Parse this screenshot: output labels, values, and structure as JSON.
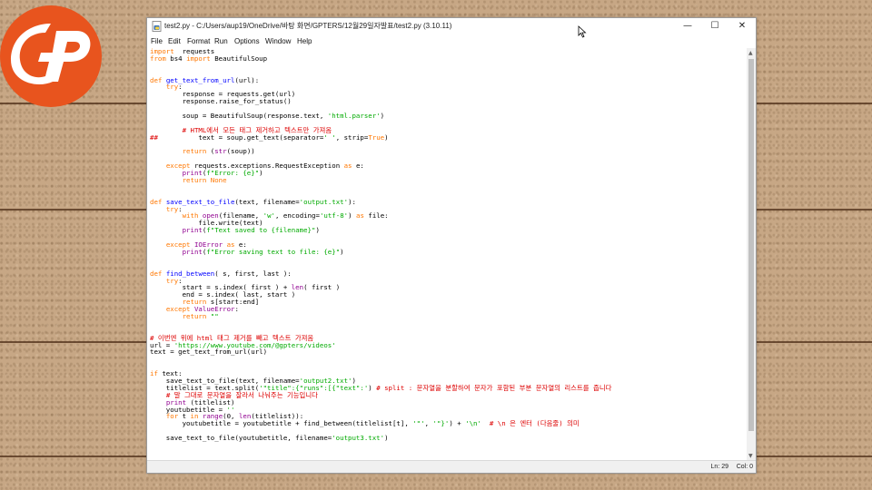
{
  "window": {
    "title": "test2.py - C:/Users/aup19/OneDrive/바탕 화면/GPTERS/12월29일자발표/test2.py (3.10.11)",
    "controls": {
      "minimize": "—",
      "maximize": "☐",
      "close": "✕"
    }
  },
  "menu": [
    "File",
    "Edit",
    "Format",
    "Run",
    "Options",
    "Window",
    "Help"
  ],
  "code": [
    [
      [
        "kw",
        "import"
      ],
      [
        "",
        "  requests"
      ]
    ],
    [
      [
        "kw",
        "from"
      ],
      [
        "",
        " bs4 "
      ],
      [
        "kw",
        "import"
      ],
      [
        "",
        " BeautifulSoup"
      ]
    ],
    [],
    [],
    [
      [
        "kw",
        "def"
      ],
      [
        "",
        " "
      ],
      [
        "df",
        "get_text_from_url"
      ],
      [
        "",
        "(url):"
      ]
    ],
    [
      [
        "",
        "    "
      ],
      [
        "kw",
        "try"
      ],
      [
        "",
        ":"
      ]
    ],
    [
      [
        "",
        "        response = requests.get(url)"
      ]
    ],
    [
      [
        "",
        "        response.raise_for_status()"
      ]
    ],
    [],
    [
      [
        "",
        "        soup = BeautifulSoup(response.text, "
      ],
      [
        "st",
        "'html.parser'"
      ],
      [
        "",
        ")"
      ]
    ],
    [],
    [
      [
        "",
        "        "
      ],
      [
        "cm",
        "# HTML에서 모든 태그 제거하고 텍스트만 가져옴"
      ]
    ],
    [
      [
        "cm",
        "##"
      ],
      [
        "",
        "          text = soup.get_text(separator="
      ],
      [
        "st",
        "' '"
      ],
      [
        "",
        ", strip="
      ],
      [
        "kw",
        "True"
      ],
      [
        "",
        ")"
      ]
    ],
    [],
    [
      [
        "",
        "        "
      ],
      [
        "kw",
        "return"
      ],
      [
        "",
        " ("
      ],
      [
        "bi",
        "str"
      ],
      [
        "",
        "(soup))"
      ]
    ],
    [],
    [
      [
        "",
        "    "
      ],
      [
        "kw",
        "except"
      ],
      [
        "",
        " requests.exceptions.RequestException "
      ],
      [
        "kw",
        "as"
      ],
      [
        "",
        " e:"
      ]
    ],
    [
      [
        "",
        "        "
      ],
      [
        "bi",
        "print"
      ],
      [
        "",
        "("
      ],
      [
        "st",
        "f\"Error: {e}\""
      ],
      [
        "",
        ")"
      ]
    ],
    [
      [
        "",
        "        "
      ],
      [
        "kw",
        "return"
      ],
      [
        "",
        " "
      ],
      [
        "kw",
        "None"
      ]
    ],
    [],
    [],
    [
      [
        "kw",
        "def"
      ],
      [
        "",
        " "
      ],
      [
        "df",
        "save_text_to_file"
      ],
      [
        "",
        "(text, filename="
      ],
      [
        "st",
        "'output.txt'"
      ],
      [
        "",
        "):"
      ]
    ],
    [
      [
        "",
        "    "
      ],
      [
        "kw",
        "try"
      ],
      [
        "",
        ":"
      ]
    ],
    [
      [
        "",
        "        "
      ],
      [
        "kw",
        "with"
      ],
      [
        "",
        " "
      ],
      [
        "bi",
        "open"
      ],
      [
        "",
        "(filename, "
      ],
      [
        "st",
        "'w'"
      ],
      [
        "",
        ", encoding="
      ],
      [
        "st",
        "'utf-8'"
      ],
      [
        "",
        ") "
      ],
      [
        "kw",
        "as"
      ],
      [
        "",
        " file:"
      ]
    ],
    [
      [
        "",
        "            file.write(text)"
      ]
    ],
    [
      [
        "",
        "        "
      ],
      [
        "bi",
        "print"
      ],
      [
        "",
        "("
      ],
      [
        "st",
        "f\"Text saved to {filename}\""
      ],
      [
        "",
        ")"
      ]
    ],
    [],
    [
      [
        "",
        "    "
      ],
      [
        "kw",
        "except"
      ],
      [
        "",
        " "
      ],
      [
        "bi",
        "IOError"
      ],
      [
        "",
        " "
      ],
      [
        "kw",
        "as"
      ],
      [
        "",
        " e:"
      ]
    ],
    [
      [
        "",
        "        "
      ],
      [
        "bi",
        "print"
      ],
      [
        "",
        "("
      ],
      [
        "st",
        "f\"Error saving text to file: {e}\""
      ],
      [
        "",
        ")"
      ]
    ],
    [],
    [],
    [
      [
        "kw",
        "def"
      ],
      [
        "",
        " "
      ],
      [
        "df",
        "find_between"
      ],
      [
        "",
        "( s, first, last ):"
      ]
    ],
    [
      [
        "",
        "    "
      ],
      [
        "kw",
        "try"
      ],
      [
        "",
        ":"
      ]
    ],
    [
      [
        "",
        "        start = s.index( first ) + "
      ],
      [
        "bi",
        "len"
      ],
      [
        "",
        "( first )"
      ]
    ],
    [
      [
        "",
        "        end = s.index( last, start )"
      ]
    ],
    [
      [
        "",
        "        "
      ],
      [
        "kw",
        "return"
      ],
      [
        "",
        " s[start:end]"
      ]
    ],
    [
      [
        "",
        "    "
      ],
      [
        "kw",
        "except"
      ],
      [
        "",
        " "
      ],
      [
        "bi",
        "ValueError"
      ],
      [
        "",
        ":"
      ]
    ],
    [
      [
        "",
        "        "
      ],
      [
        "kw",
        "return"
      ],
      [
        "",
        " "
      ],
      [
        "st",
        "\"\""
      ]
    ],
    [],
    [],
    [
      [
        "cm",
        "# 이번엔 위에 html 태그 제거를 빼고 텍스트 가져옴"
      ]
    ],
    [
      [
        "",
        "url = "
      ],
      [
        "st",
        "'https://www.youtube.com/@gpters/videos'"
      ]
    ],
    [
      [
        "",
        "text = get_text_from_url(url)"
      ]
    ],
    [],
    [],
    [
      [
        "kw",
        "if"
      ],
      [
        "",
        " text:"
      ]
    ],
    [
      [
        "",
        "    save_text_to_file(text, filename="
      ],
      [
        "st",
        "'output2.txt'"
      ],
      [
        "",
        ")"
      ]
    ],
    [
      [
        "",
        "    titlelist = text.split("
      ],
      [
        "st",
        "'\"title\":{\"runs\":[{\"text\":'"
      ],
      [
        "",
        ") "
      ],
      [
        "cm",
        "# split : 문자열을 분할하여 문자가 포함된 부분 문자열의 리스트를 줍니다"
      ]
    ],
    [
      [
        "",
        "    "
      ],
      [
        "cm",
        "# 말 그대로 문자열을 잘라서 나눠주는 기능입니다"
      ]
    ],
    [
      [
        "",
        "    "
      ],
      [
        "bi",
        "print"
      ],
      [
        "",
        " (titlelist)"
      ]
    ],
    [
      [
        "",
        "    youtubetitle = "
      ],
      [
        "st",
        "''"
      ]
    ],
    [
      [
        "",
        "    "
      ],
      [
        "kw",
        "for"
      ],
      [
        "",
        " t "
      ],
      [
        "kw",
        "in"
      ],
      [
        "",
        " "
      ],
      [
        "bi",
        "range"
      ],
      [
        "",
        "(0, "
      ],
      [
        "bi",
        "len"
      ],
      [
        "",
        "(titlelist)):"
      ]
    ],
    [
      [
        "",
        "        youtubetitle = youtubetitle + find_between(titlelist[t], "
      ],
      [
        "st",
        "'\"'"
      ],
      [
        "",
        ", "
      ],
      [
        "st",
        "'\"}'"
      ],
      [
        "",
        ") + "
      ],
      [
        "st",
        "'\\n'"
      ],
      [
        "",
        "  "
      ],
      [
        "cm",
        "# \\n 은 엔터 (다음줄) 의미"
      ]
    ],
    [],
    [
      [
        "",
        "    save_text_to_file(youtubetitle, filename="
      ],
      [
        "st",
        "'output3.txt'"
      ],
      [
        "",
        ")"
      ]
    ]
  ],
  "status": {
    "line": "Ln: 29",
    "col": "Col: 0"
  },
  "colors": {
    "keyword": "#ff7700",
    "builtin": "#900090",
    "string": "#00aa00",
    "comment": "#dd0000",
    "definition": "#0000ff",
    "logo": "#e8541e"
  }
}
